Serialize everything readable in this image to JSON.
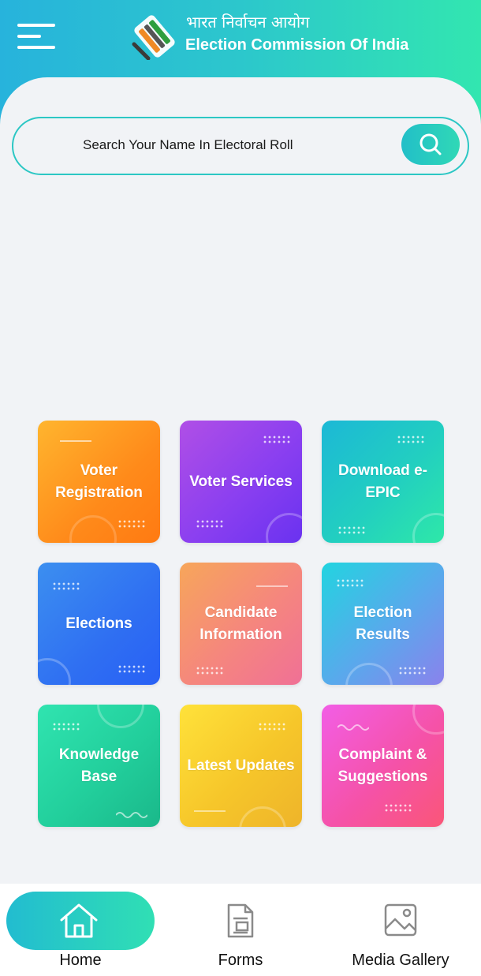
{
  "header": {
    "title_hindi": "भारत निर्वाचन आयोग",
    "title_english": "Election Commission Of India"
  },
  "search": {
    "placeholder": "Search Your Name In Electoral Roll"
  },
  "tiles": [
    {
      "label": "Voter Registration"
    },
    {
      "label": "Voter Services"
    },
    {
      "label": "Download e-EPIC"
    },
    {
      "label": "Elections"
    },
    {
      "label": "Candidate Information"
    },
    {
      "label": "Election Results"
    },
    {
      "label": "Knowledge Base"
    },
    {
      "label": "Latest Updates"
    },
    {
      "label": "Complaint & Suggestions"
    }
  ],
  "bottom_nav": {
    "items": [
      {
        "label": "Home",
        "active": true
      },
      {
        "label": "Forms",
        "active": false
      },
      {
        "label": "Media Gallery",
        "active": false
      }
    ]
  },
  "colors": {
    "accent": "#2cc7c4",
    "header_start": "#27b3dc",
    "header_end": "#32e6b0"
  },
  "icons": {
    "menu": "hamburger-menu-icon",
    "logo": "eci-logo-icon",
    "search": "search-icon",
    "home": "home-icon",
    "forms": "document-icon",
    "media": "image-icon"
  }
}
